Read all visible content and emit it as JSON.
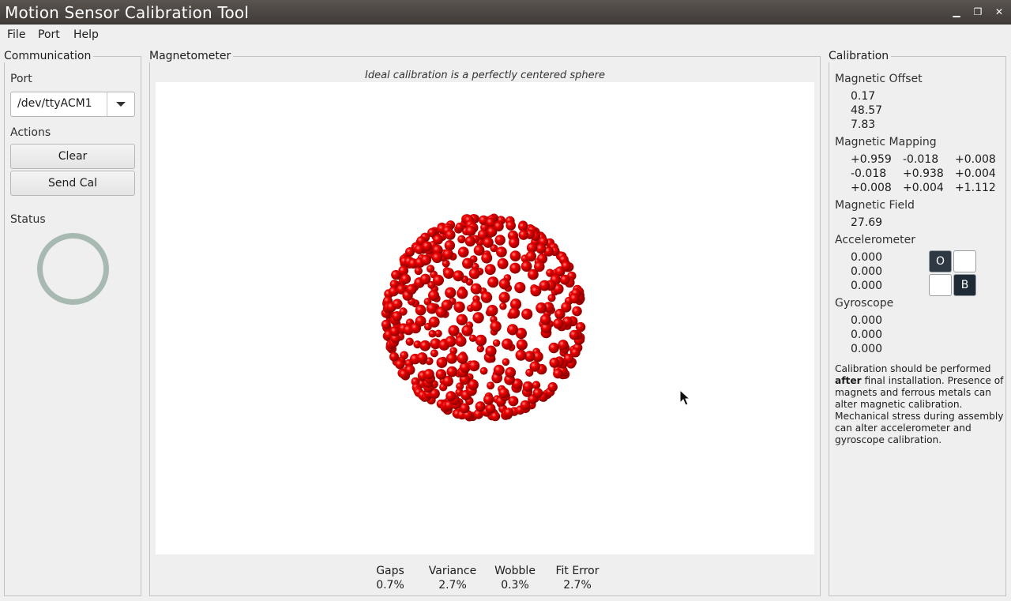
{
  "window": {
    "title": "Motion Sensor Calibration Tool",
    "min": "▁",
    "max": "❐",
    "close": "✕"
  },
  "menu": [
    "File",
    "Port",
    "Help"
  ],
  "communication": {
    "title": "Communication",
    "port_label": "Port",
    "port_value": "/dev/ttyACM1",
    "actions_label": "Actions",
    "clear_label": "Clear",
    "send_label": "Send Cal",
    "status_label": "Status",
    "status_color": "#a7b9b1"
  },
  "magnetometer": {
    "title": "Magnetometer",
    "caption": "Ideal calibration is a perfectly centered sphere",
    "point_color": "#e00000",
    "metrics": [
      {
        "label": "Gaps",
        "value": "0.7%"
      },
      {
        "label": "Variance",
        "value": "2.7%"
      },
      {
        "label": "Wobble",
        "value": "0.3%"
      },
      {
        "label": "Fit Error",
        "value": "2.7%"
      }
    ]
  },
  "calibration": {
    "title": "Calibration",
    "offset_label": "Magnetic Offset",
    "offset": [
      "0.17",
      "48.57",
      "7.83"
    ],
    "mapping_label": "Magnetic Mapping",
    "mapping": [
      [
        "+0.959",
        "-0.018",
        "+0.008"
      ],
      [
        "-0.018",
        "+0.938",
        "+0.004"
      ],
      [
        "+0.008",
        "+0.004",
        "+1.112"
      ]
    ],
    "field_label": "Magnetic Field",
    "field": "27.69",
    "accel_label": "Accelerometer",
    "accel": [
      "0.000",
      "0.000",
      "0.000"
    ],
    "orientation": [
      "O",
      "",
      "",
      "B"
    ],
    "gyro_label": "Gyroscope",
    "gyro": [
      "0.000",
      "0.000",
      "0.000"
    ],
    "note_pre": "Calibration should be performed ",
    "note_bold": "after",
    "note_post": " final installation.  Presence of magnets and ferrous metals can alter magnetic calibration. Mechanical stress during assembly can alter accelerometer and gyroscope calibration."
  }
}
